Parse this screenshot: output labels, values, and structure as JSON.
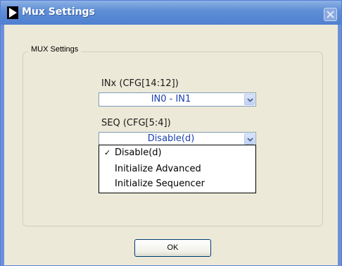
{
  "window": {
    "title": "Mux Settings"
  },
  "group": {
    "legend": "MUX Settings"
  },
  "inx": {
    "label": "INx  (CFG[14:12])",
    "value": "IN0 - IN1"
  },
  "seq": {
    "label": "SEQ  (CFG[5:4])",
    "value": "Disable(d)",
    "options": [
      {
        "label": "Disable(d)",
        "checked": true
      },
      {
        "label": "Initialize Advanced",
        "checked": false
      },
      {
        "label": "Initialize Sequencer",
        "checked": false
      }
    ]
  },
  "check_mark": "✓",
  "buttons": {
    "ok": "OK"
  },
  "icons": {
    "title": "play-triangle-icon",
    "close": "close-icon",
    "combo_arrow": "chevron-down-icon"
  },
  "colors": {
    "title_bar": "#5f8fd6",
    "window_bg": "#ece9d8",
    "combo_text": "#1a3fb0"
  }
}
